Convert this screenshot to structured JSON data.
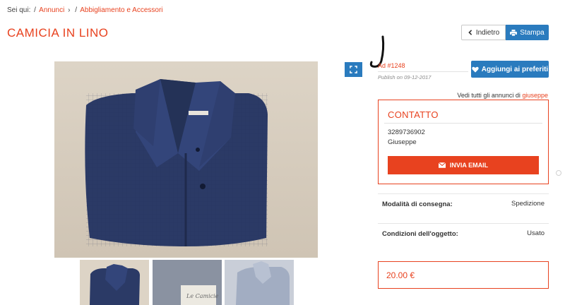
{
  "breadcrumb": {
    "prefix": "Sei qui:",
    "items": [
      "Annunci",
      "Abbigliamento e Accessori"
    ]
  },
  "title": "CAMICIA IN LINO",
  "toolbar": {
    "back_label": "Indietro",
    "print_label": "Stampa"
  },
  "ad": {
    "id": "Ad #1248",
    "publish": "Publish on 09-12-2017"
  },
  "favorites_label": "Aggiungi ai preferiti",
  "all_ads": {
    "text": "Vedi tutti gli annunci di",
    "user": "giuseppe"
  },
  "contact": {
    "title": "CONTATTO",
    "phone": "3289736902",
    "name": "Giuseppe",
    "email_button": "INVIA EMAIL"
  },
  "details": [
    {
      "label": "Modalità di consegna:",
      "value": "Spedizione"
    },
    {
      "label": "Condizioni dell'oggetto:",
      "value": "Usato"
    }
  ],
  "price": "20.00 €",
  "thumb2_caption": "Le Camicie",
  "colors": {
    "accent": "#e8421f",
    "primary_blue": "#2a7bbe",
    "shirt": "#2b3a66"
  },
  "icons": [
    "chevron-left-icon",
    "print-icon",
    "expand-icon",
    "heart-icon",
    "envelope-icon"
  ]
}
